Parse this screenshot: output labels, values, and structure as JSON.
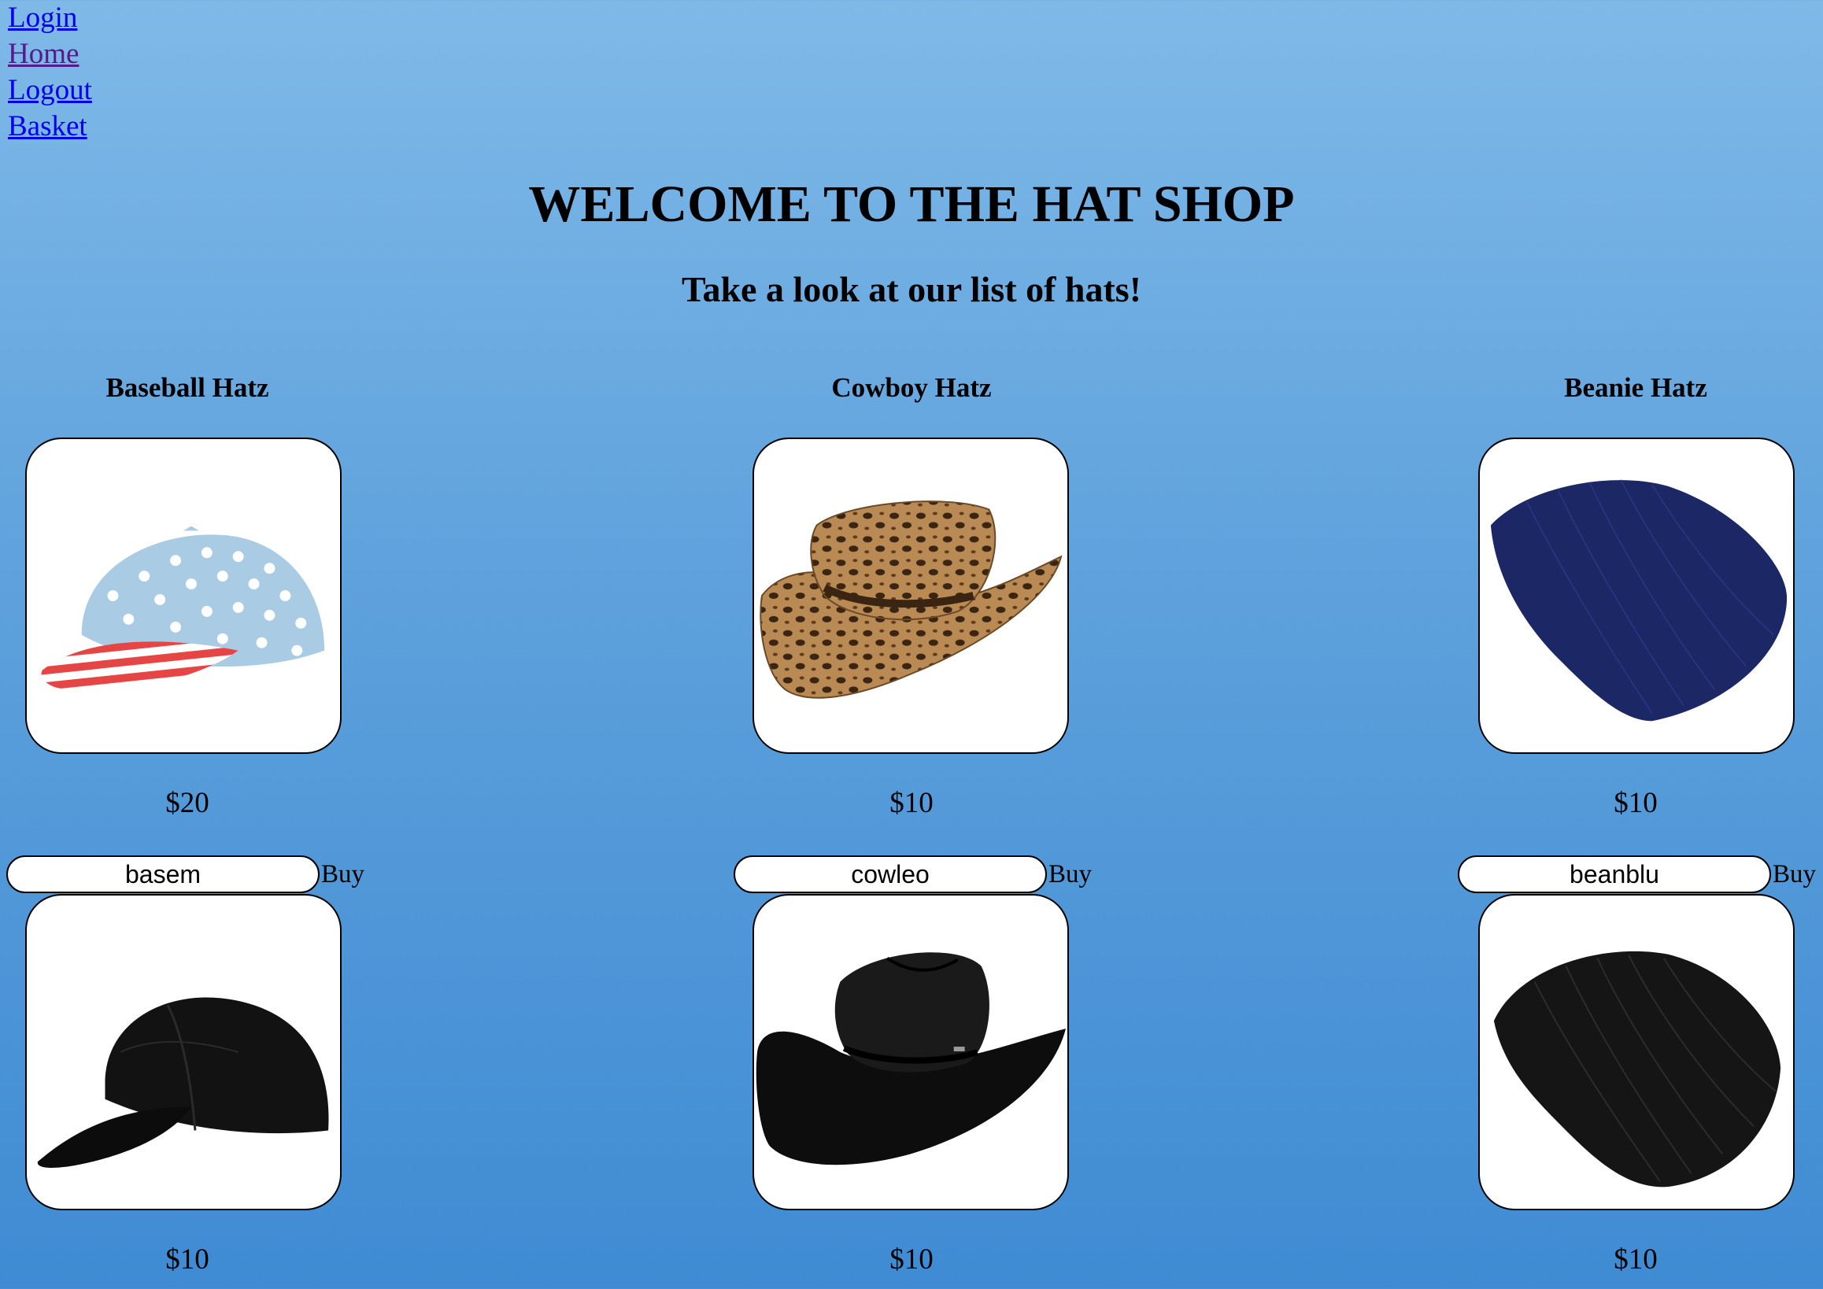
{
  "nav": {
    "login": "Login",
    "home": "Home",
    "logout": "Logout",
    "basket": "Basket"
  },
  "header": {
    "title": "WELCOME TO THE HAT SHOP",
    "subtitle": "Take a look at our list of hats!"
  },
  "categories": [
    {
      "name": "Baseball Hatz",
      "items": [
        {
          "image": "stars-and-stripes-baseball-cap",
          "price": "$20",
          "code": "basem",
          "buy_label": "Buy"
        },
        {
          "image": "black-baseball-cap",
          "price": "$10"
        }
      ]
    },
    {
      "name": "Cowboy Hatz",
      "items": [
        {
          "image": "leopard-print-cowboy-hat",
          "price": "$10",
          "code": "cowleo",
          "buy_label": "Buy"
        },
        {
          "image": "black-cowboy-hat",
          "price": "$10"
        }
      ]
    },
    {
      "name": "Beanie Hatz",
      "items": [
        {
          "image": "navy-slouch-beanie",
          "price": "$10",
          "code": "beanblu",
          "buy_label": "Buy"
        },
        {
          "image": "black-slouch-beanie",
          "price": "$10"
        }
      ]
    }
  ],
  "colors": {
    "link": "#0000ee",
    "visited_link": "#551a8b",
    "background_top": "#7fb9e8",
    "background_bottom": "#3f8bd3"
  }
}
